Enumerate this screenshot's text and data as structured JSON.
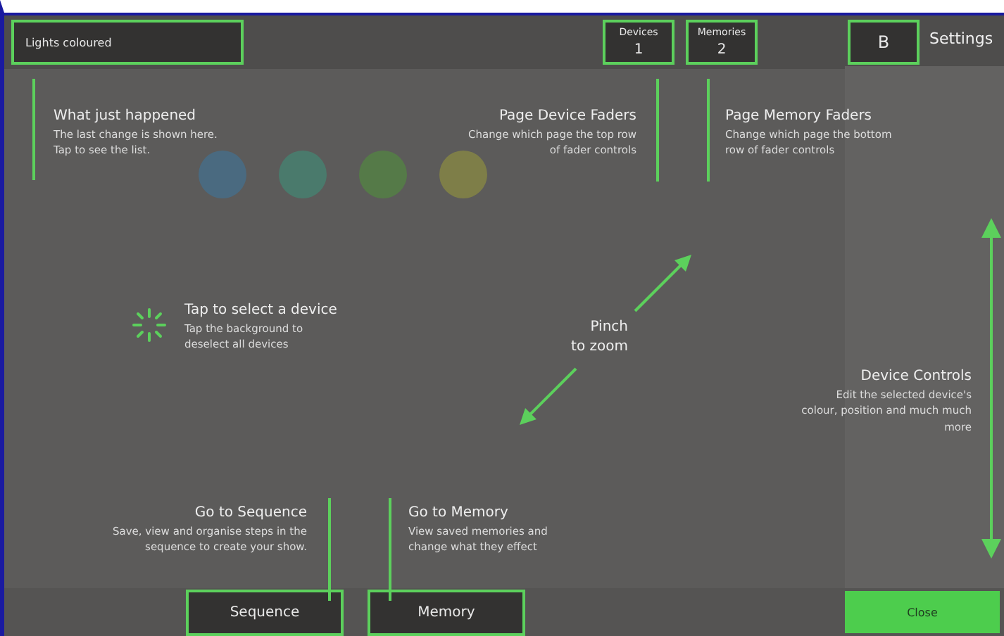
{
  "top_bar": {
    "last_change": "Lights coloured",
    "device_page": {
      "label": "Devices",
      "value": "1"
    },
    "memory_page": {
      "label": "Memories",
      "value": "2"
    },
    "b_button": "B",
    "settings": "Settings"
  },
  "background": {
    "devices": [
      {
        "color": "#4a6a80"
      },
      {
        "color": "#4a7a6c"
      },
      {
        "color": "#557a48"
      },
      {
        "color": "#7e7e48"
      }
    ]
  },
  "tips": [
    {
      "kind": "top-left",
      "title": "What just happened",
      "body": "The last change is shown here. Tap to see the list."
    },
    {
      "kind": "top-right",
      "title": "Page Device Faders",
      "body": "Change which page the top row of fader controls"
    },
    {
      "kind": "top-left",
      "title": "Page Memory Faders",
      "body": "Change which page the bottom row of fader controls"
    },
    {
      "kind": "select",
      "title": "Tap to select a device",
      "body": "Tap the background to deselect all devices"
    },
    {
      "kind": "pinch",
      "title": "Pinch",
      "body": "to zoom"
    },
    {
      "kind": "side",
      "title": "Device Controls",
      "body": "Edit the selected device's colour, position and much much more"
    },
    {
      "kind": "bottom-right",
      "title": "Go to Sequence",
      "body": "Save, view and organise steps in the sequence to create your show."
    },
    {
      "kind": "bottom-left",
      "title": "Go to Memory",
      "body": "View saved memories and change what they effect"
    }
  ],
  "bottom_bar": {
    "sequence": "Sequence",
    "memory": "Memory",
    "close": "Close"
  }
}
